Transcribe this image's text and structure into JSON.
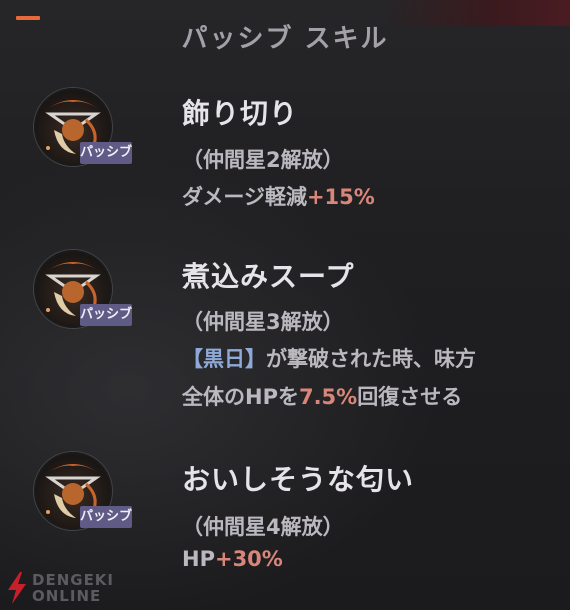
{
  "header": {
    "title": "パッシブ スキル"
  },
  "badge_label": "パッシブ",
  "skills": [
    {
      "name": "飾り切り",
      "unlock": "（仲間星2解放）",
      "desc1_pre": "ダメージ軽減",
      "desc1_val": "+15%"
    },
    {
      "name": "煮込みスープ",
      "unlock": "（仲間星3解放）",
      "desc1_tag": "【黒日】",
      "desc1_rest": "が撃破された時、味方",
      "desc2_pre": "全体のHPを",
      "desc2_val": "7.5%",
      "desc2_post": "回復させる"
    },
    {
      "name": "おいしそうな匂い",
      "unlock": "（仲間星4解放）",
      "desc1_pre": "HP",
      "desc1_val": "+30%"
    }
  ],
  "watermark": {
    "line1": "DENGEKI",
    "line2": "ONLINE"
  },
  "colors": {
    "accent": "#e86a3a",
    "badge": "#5f5a86",
    "highlight": "#d9867a",
    "tag": "#8fa9d8"
  }
}
